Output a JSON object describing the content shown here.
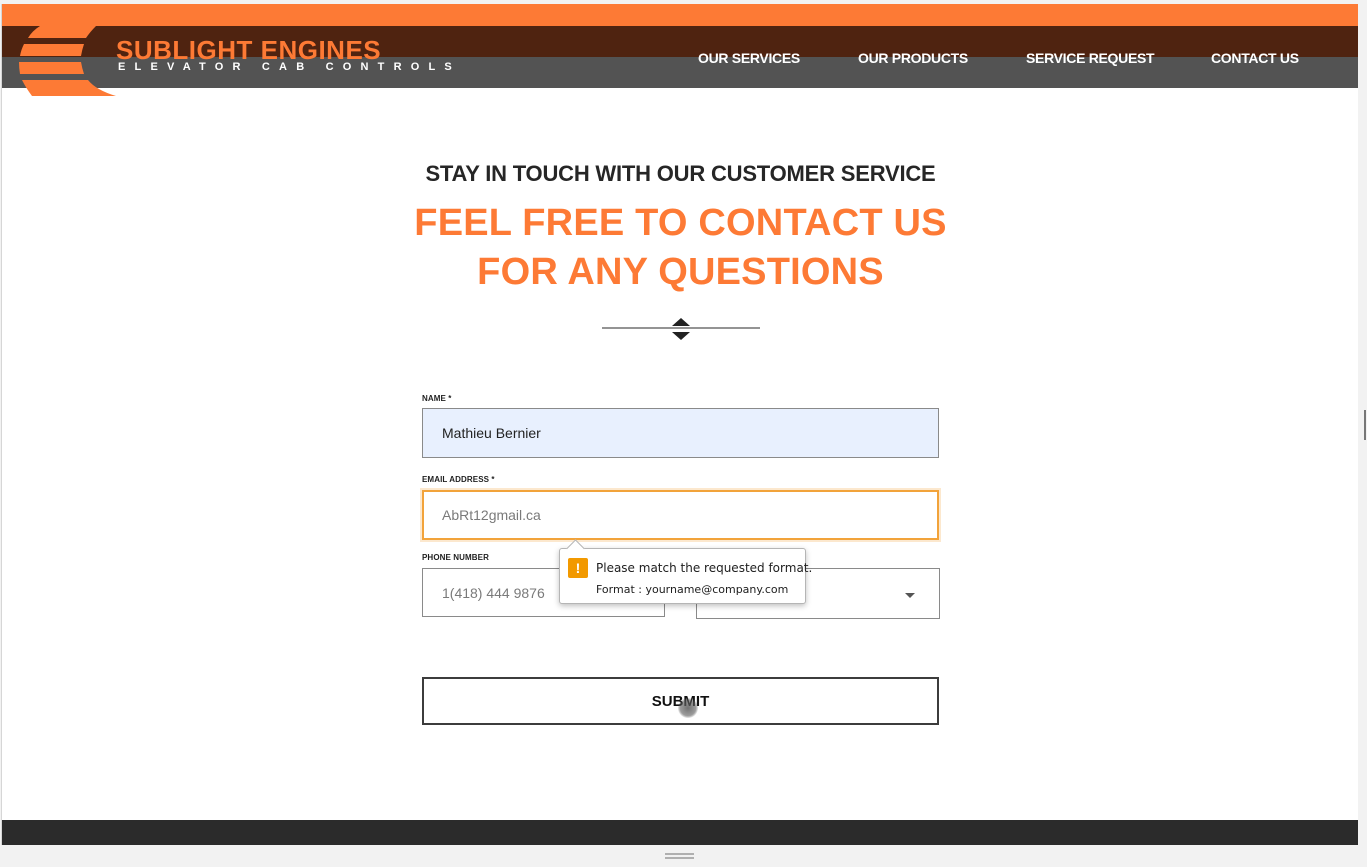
{
  "brand": {
    "name": "SUBLIGHT ENGINES",
    "tagline": "ELEVATOR CAB CONTROLS",
    "colors": {
      "accent": "#fd7a35",
      "dark_brown": "#4f2310",
      "gray": "#535353",
      "footer": "#2b2b2b"
    }
  },
  "nav": {
    "items": [
      {
        "label": "OUR SERVICES"
      },
      {
        "label": "OUR PRODUCTS"
      },
      {
        "label": "SERVICE REQUEST"
      },
      {
        "label": "CONTACT US"
      }
    ]
  },
  "hero": {
    "subhead": "STAY IN TOUCH WITH OUR CUSTOMER SERVICE",
    "headline_line1": "FEEL FREE TO CONTACT US",
    "headline_line2": "FOR ANY QUESTIONS",
    "divider_icon": "double-chevron-icon"
  },
  "form": {
    "name": {
      "label": "NAME *",
      "value": "Mathieu Bernier"
    },
    "email": {
      "label": "EMAIL ADDRESS *",
      "value": "AbRt12gmail.ca"
    },
    "phone": {
      "label": "PHONE NUMBER",
      "placeholder": "1(418) 444 9876"
    },
    "select": {
      "value": "",
      "icon": "caret-down-icon"
    },
    "submit_label": "SUBMIT"
  },
  "validation_tooltip": {
    "icon": "warning-icon",
    "message": "Please match the requested format.",
    "detail": "Format : yourname@company.com"
  }
}
